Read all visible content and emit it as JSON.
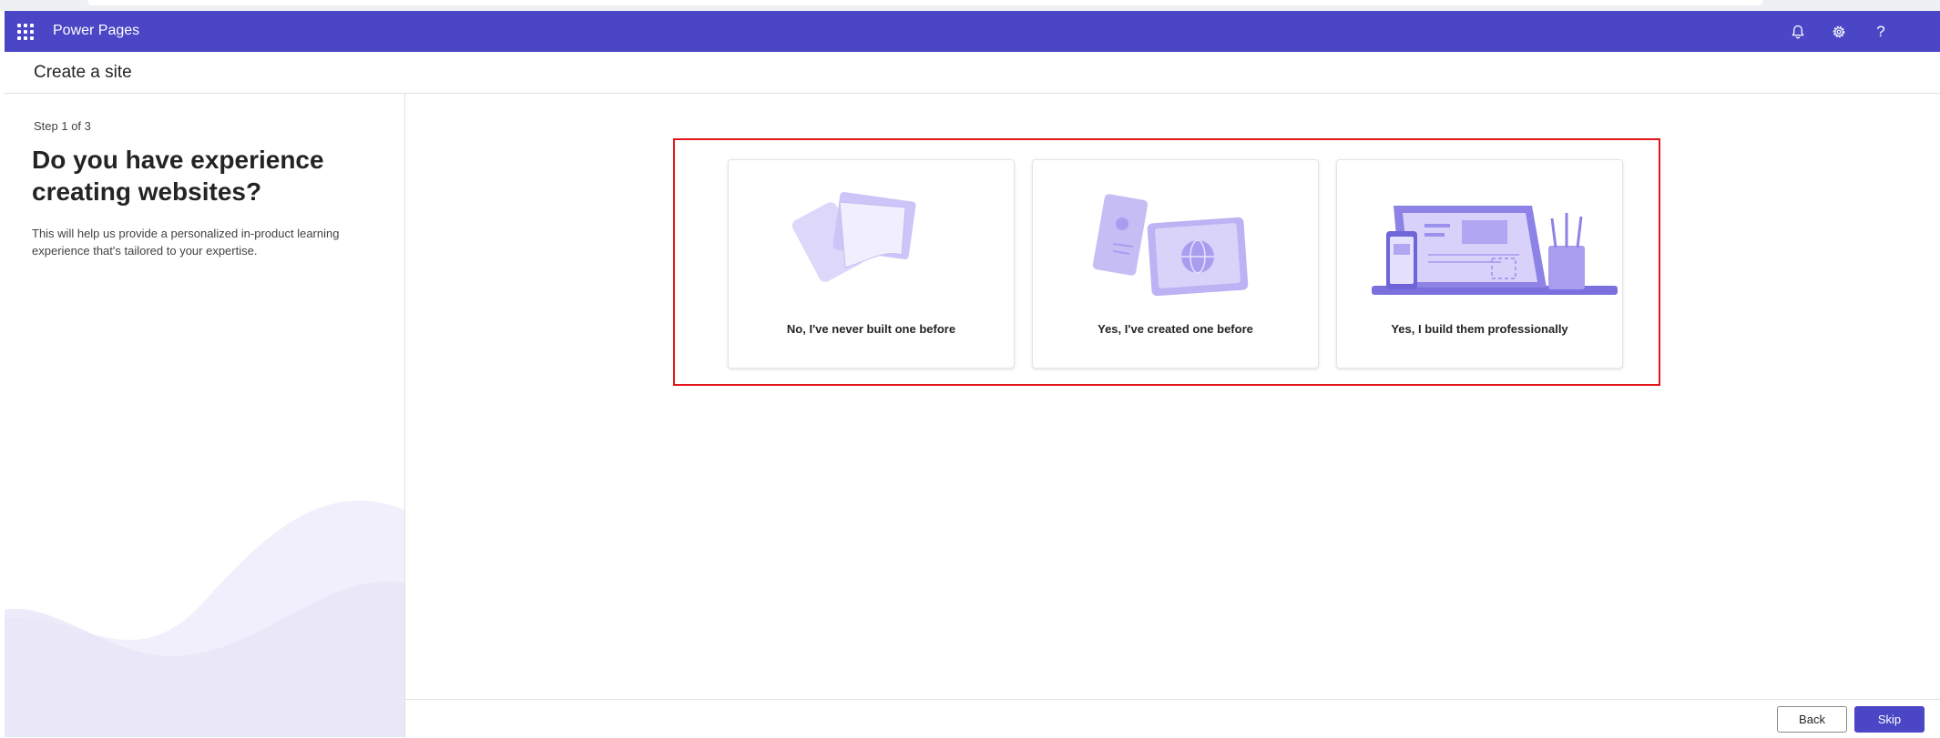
{
  "header": {
    "app_name": "Power Pages",
    "icons": [
      "waffle-icon",
      "bell-icon",
      "gear-icon",
      "help-icon"
    ],
    "help_glyph": "?"
  },
  "command_bar": {
    "title": "Create a site"
  },
  "left_panel": {
    "step": "Step 1 of 3",
    "question": "Do you have experience creating websites?",
    "description": "This will help us provide a personalized in-product learning experience that's tailored to your expertise."
  },
  "options": [
    {
      "label": "No, I've never built one before",
      "icon": "blank-pages-illustration"
    },
    {
      "label": "Yes, I've created one before",
      "icon": "website-globe-illustration"
    },
    {
      "label": "Yes, I build them professionally",
      "icon": "designer-workspace-illustration"
    }
  ],
  "footer": {
    "back_label": "Back",
    "skip_label": "Skip"
  },
  "colors": {
    "brand": "#4a46c5",
    "highlight": "#e3171b",
    "illustration": "#b8b0f0"
  }
}
